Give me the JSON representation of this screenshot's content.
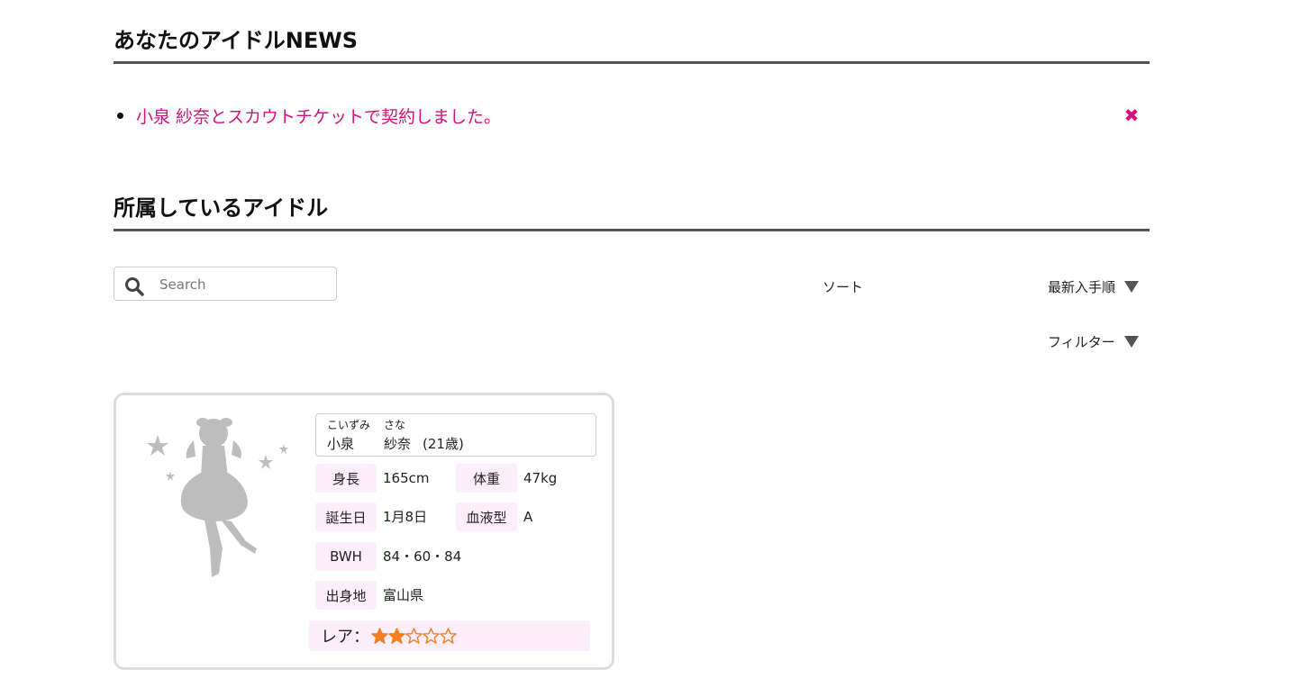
{
  "news": {
    "title": "あなたのアイドルNEWS",
    "items": [
      {
        "text": "小泉 紗奈とスカウトチケットで契約しました。",
        "close_icon": "close-icon"
      }
    ]
  },
  "idols": {
    "title": "所属しているアイドル",
    "search": {
      "placeholder": "Search",
      "value": "",
      "icon": "search-icon"
    },
    "sort_label": "ソート",
    "sort_value": "最新入手順",
    "filter_label": "フィルター"
  },
  "card": {
    "ruby_family": "こいずみ",
    "ruby_given": "さな",
    "family_name": "小泉",
    "given_name": "紗奈",
    "age": "(21歳)",
    "height_label": "身長",
    "height": "165cm",
    "weight_label": "体重",
    "weight": "47kg",
    "birthday_label": "誕生日",
    "birthday": "1月8日",
    "blood_label": "血液型",
    "blood": "A",
    "bwh_label": "BWH",
    "bwh": "84・60・84",
    "hometown_label": "出身地",
    "hometown": "富山県",
    "rarity_label": "レア：",
    "rarity": 2,
    "rarity_max": 5
  },
  "colors": {
    "accent": "#d6117b",
    "label_bg": "#fdeefb",
    "star": "#f57f20",
    "silhouette": "#bdbdbd"
  }
}
